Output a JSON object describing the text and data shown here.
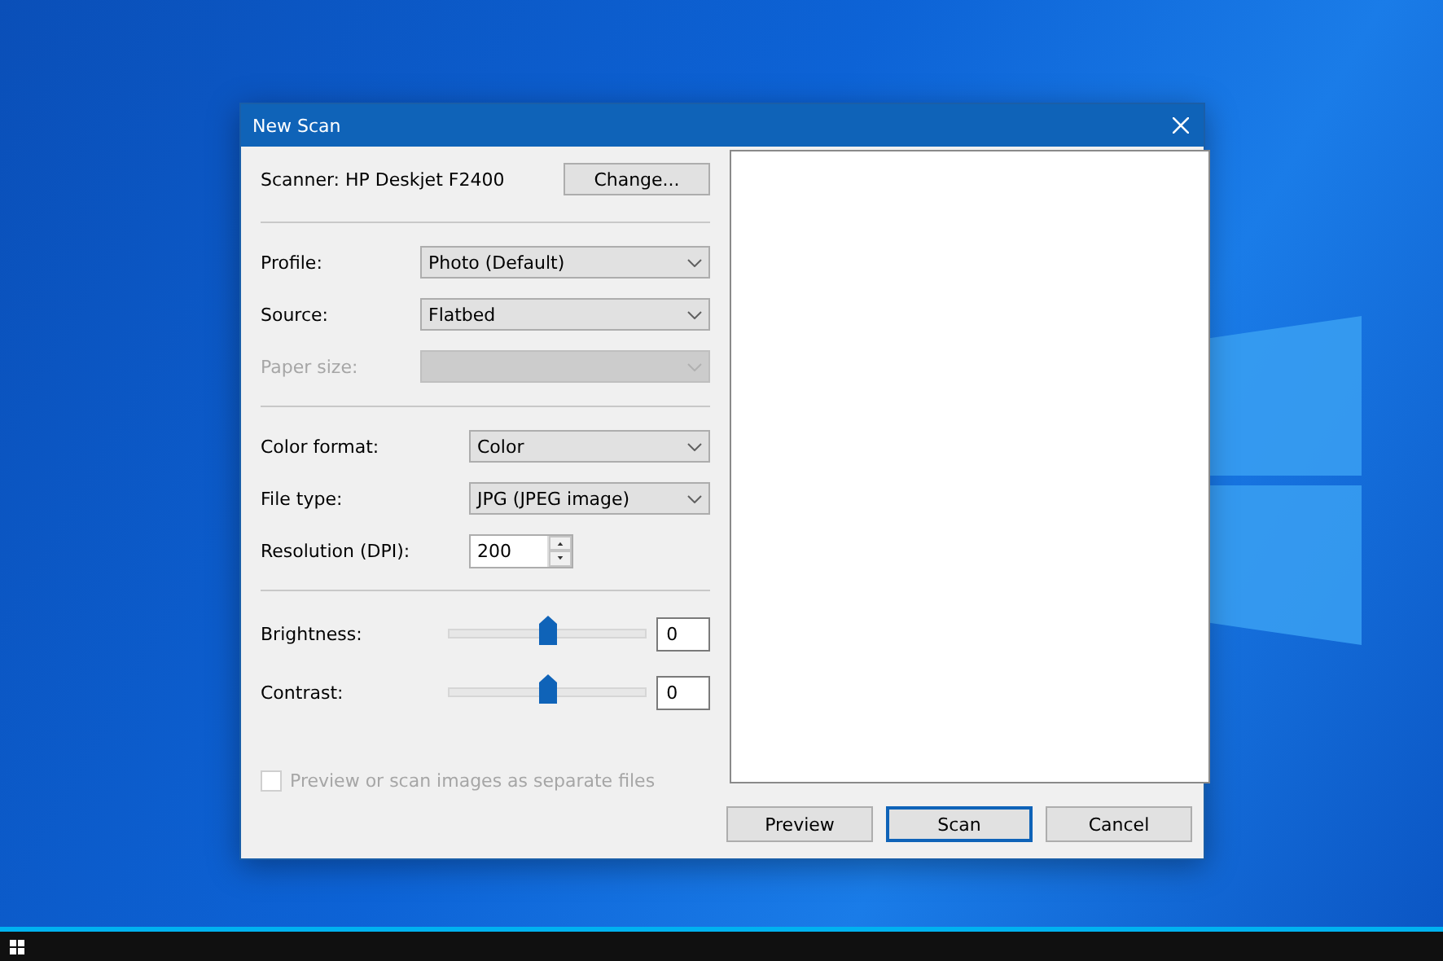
{
  "window": {
    "title": "New Scan"
  },
  "scanner": {
    "label": "Scanner: HP Deskjet F2400",
    "button": "Change..."
  },
  "sections": [
    {
      "fields": [
        {
          "kind": "dropdown",
          "label": "Profile:",
          "value": "Photo (Default)",
          "disabled": false
        },
        {
          "kind": "dropdown",
          "label": "Source:",
          "value": "Flatbed",
          "disabled": false
        },
        {
          "kind": "dropdown",
          "label": "Paper size:",
          "disabled": true
        }
      ]
    },
    {
      "fields": [
        {
          "kind": "dropdown",
          "label": "Color format:",
          "value": "Color",
          "disabled": false
        },
        {
          "kind": "dropdown",
          "label": "File type:",
          "value": "JPG (JPEG image)",
          "disabled": false
        },
        {
          "kind": "spinner",
          "label": "Resolution (DPI):",
          "value": "200",
          "disabled": false
        }
      ]
    },
    {
      "fields": [
        {
          "kind": "slider",
          "label": "Brightness:",
          "level": 0.5,
          "value": "0",
          "disabled": false
        },
        {
          "kind": "slider",
          "label": "Contrast:",
          "level": 0.5,
          "value": "0",
          "disabled": false
        }
      ]
    }
  ],
  "separate_files": {
    "label": "Preview or scan images as separate files",
    "checked": false,
    "disabled": true
  },
  "buttons": [
    {
      "label": "Preview",
      "default": false
    },
    {
      "label": "Scan",
      "default": true
    },
    {
      "label": "Cancel",
      "default": false
    }
  ]
}
